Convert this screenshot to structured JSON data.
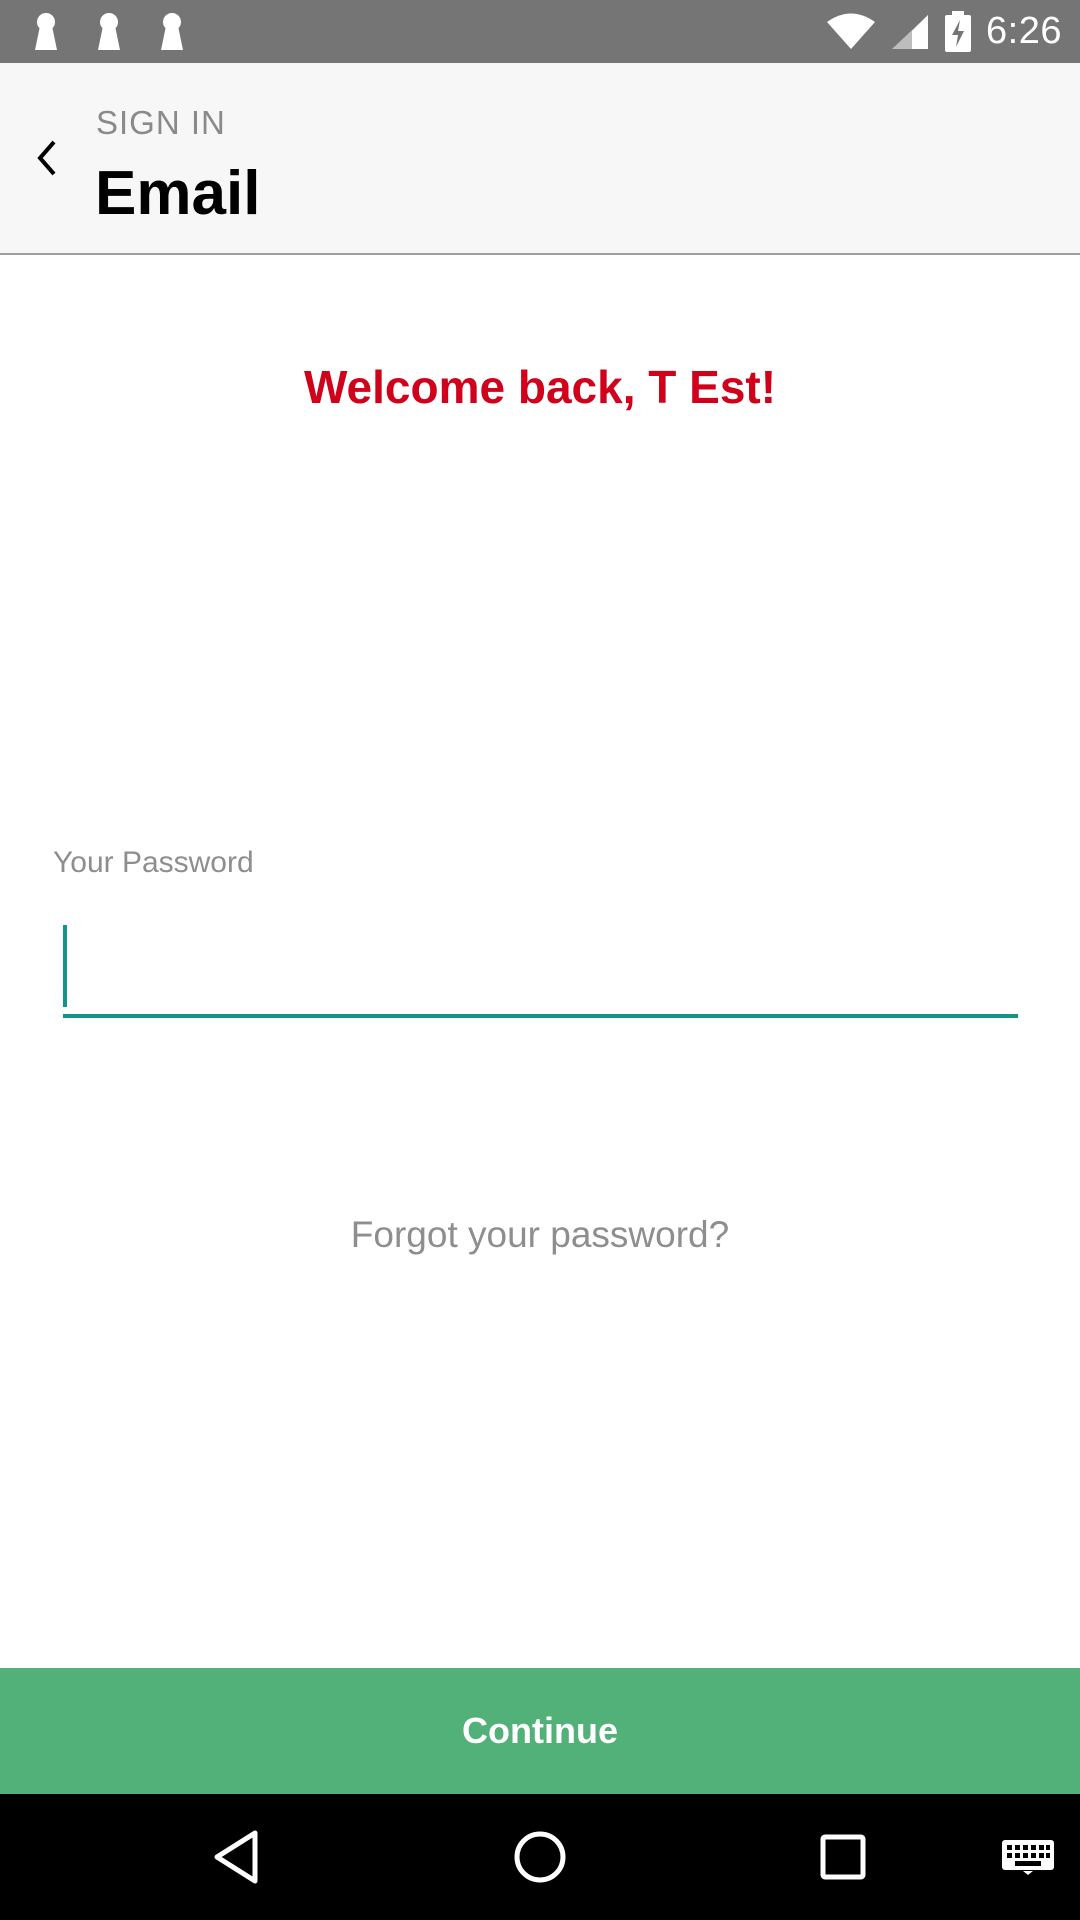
{
  "status_bar": {
    "notification_icons": [
      "keyhole-icon",
      "keyhole-icon",
      "keyhole-icon"
    ],
    "icons": [
      "wifi-icon",
      "signal-icon",
      "battery-charging-icon"
    ],
    "time": "6:26"
  },
  "header": {
    "back_icon": "chevron-left-icon",
    "overline": "SIGN IN",
    "title": "Email"
  },
  "main": {
    "welcome_text": "Welcome back, T Est!",
    "password_label": "Your Password",
    "password_value": "",
    "forgot_link": "Forgot your password?"
  },
  "footer": {
    "continue_label": "Continue"
  },
  "nav_bar": {
    "icons": [
      "back-triangle-icon",
      "home-circle-icon",
      "recents-square-icon",
      "keyboard-icon"
    ]
  },
  "colors": {
    "status_bar": "#757575",
    "header_bg": "#f7f7f7",
    "welcome": "#d0021b",
    "input_accent": "#159388",
    "button": "#51b178",
    "nav_bar": "#000000"
  }
}
